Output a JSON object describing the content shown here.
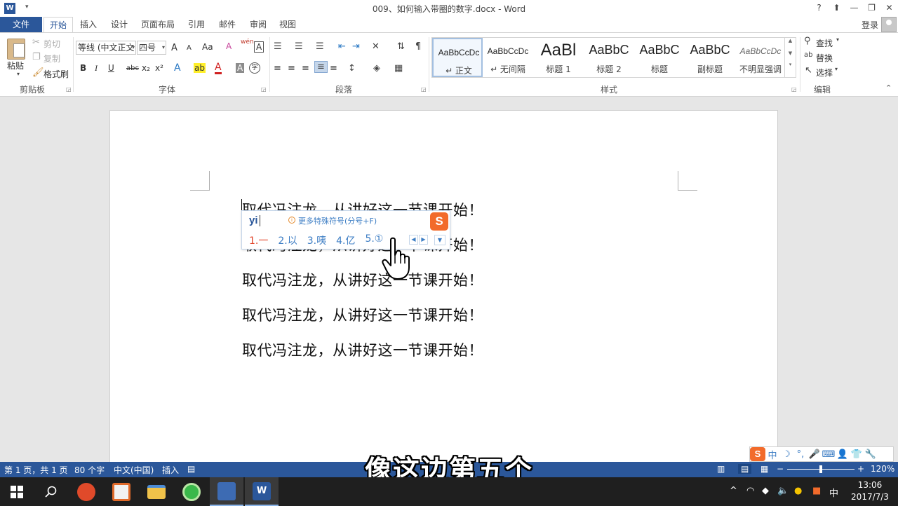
{
  "window": {
    "title": "009、如何输入带圈的数字.docx - Word",
    "help": "?",
    "controls": [
      "⬆",
      "—",
      "❐",
      "✕"
    ]
  },
  "tabs": {
    "file": "文件",
    "items": [
      "开始",
      "插入",
      "设计",
      "页面布局",
      "引用",
      "邮件",
      "审阅",
      "视图"
    ],
    "active": "开始",
    "login": "登录"
  },
  "ribbon": {
    "clipboard": {
      "label": "剪贴板",
      "paste": "粘贴",
      "cut": "剪切",
      "copy": "复制",
      "format_painter": "格式刷"
    },
    "font": {
      "label": "字体",
      "font_name": "等线 (中文正文",
      "font_size": "四号",
      "grow": "A",
      "shrink": "A",
      "change_case": "Aa",
      "clear": "A",
      "phonetic": "wén",
      "border_char": "A",
      "bold": "B",
      "italic": "I",
      "underline": "U",
      "strike": "abc",
      "subscript": "x₂",
      "superscript": "x²",
      "effects": "A",
      "highlight": "ab",
      "font_color": "A",
      "shading": "A",
      "enclose": "字"
    },
    "paragraph": {
      "label": "段落"
    },
    "styles": {
      "label": "样式",
      "items": [
        {
          "sample": "AaBbCcDc",
          "name": "↵ 正文"
        },
        {
          "sample": "AaBbCcDc",
          "name": "↵ 无间隔"
        },
        {
          "sample": "AaBl",
          "name": "标题 1"
        },
        {
          "sample": "AaBbC",
          "name": "标题 2"
        },
        {
          "sample": "AaBbC",
          "name": "标题"
        },
        {
          "sample": "AaBbC",
          "name": "副标题"
        },
        {
          "sample": "AaBbCcDc",
          "name": "不明显强调"
        }
      ]
    },
    "editing": {
      "label": "编辑",
      "find": "查找",
      "replace": "替换",
      "select": "选择"
    }
  },
  "document": {
    "lines": [
      "取代冯注龙，从讲好这一节课开始！",
      "取代冯注龙，从讲好这一节课开始！",
      "取代冯注龙，从讲好这一节课开始！",
      "取代冯注龙，从讲好这一节课开始！",
      "取代冯注龙，从讲好这一节课开始！"
    ]
  },
  "ime_popup": {
    "input": "yi",
    "hint": "更多特殊符号(分号+F)",
    "hint_icon": "i",
    "logo": "S",
    "candidates": [
      "1.一",
      "2.以",
      "3.咦",
      "4.亿",
      "5.①"
    ]
  },
  "statusbar": {
    "page": "第 1 页，共 1 页",
    "words": "80 个字",
    "language": "中文(中国)",
    "mode": "插入",
    "zoom": "120%",
    "zoom_minus": "−",
    "zoom_plus": "+"
  },
  "subtitle": "像这边第五个",
  "ime_toolbar": {
    "logo": "S",
    "items": [
      "中",
      "☽",
      "°,",
      "🎤",
      "⌨",
      "👤",
      "👕",
      "🔧"
    ]
  },
  "taskbar": {
    "apps": [
      {
        "name": "start",
        "color": "#ffffff"
      },
      {
        "name": "search",
        "color": "#ffffff"
      },
      {
        "name": "media-app",
        "color": "#e04a2a"
      },
      {
        "name": "slides-app",
        "color": "#f2f2f2"
      },
      {
        "name": "file-explorer",
        "color": "#f0c24a"
      },
      {
        "name": "browser",
        "color": "#3ab84a"
      },
      {
        "name": "mindmap-app",
        "color": "#3d6bb3"
      },
      {
        "name": "word",
        "color": "#2b579a"
      }
    ],
    "ime_indicator": "中",
    "time": "13:06",
    "date": "2017/7/3"
  }
}
